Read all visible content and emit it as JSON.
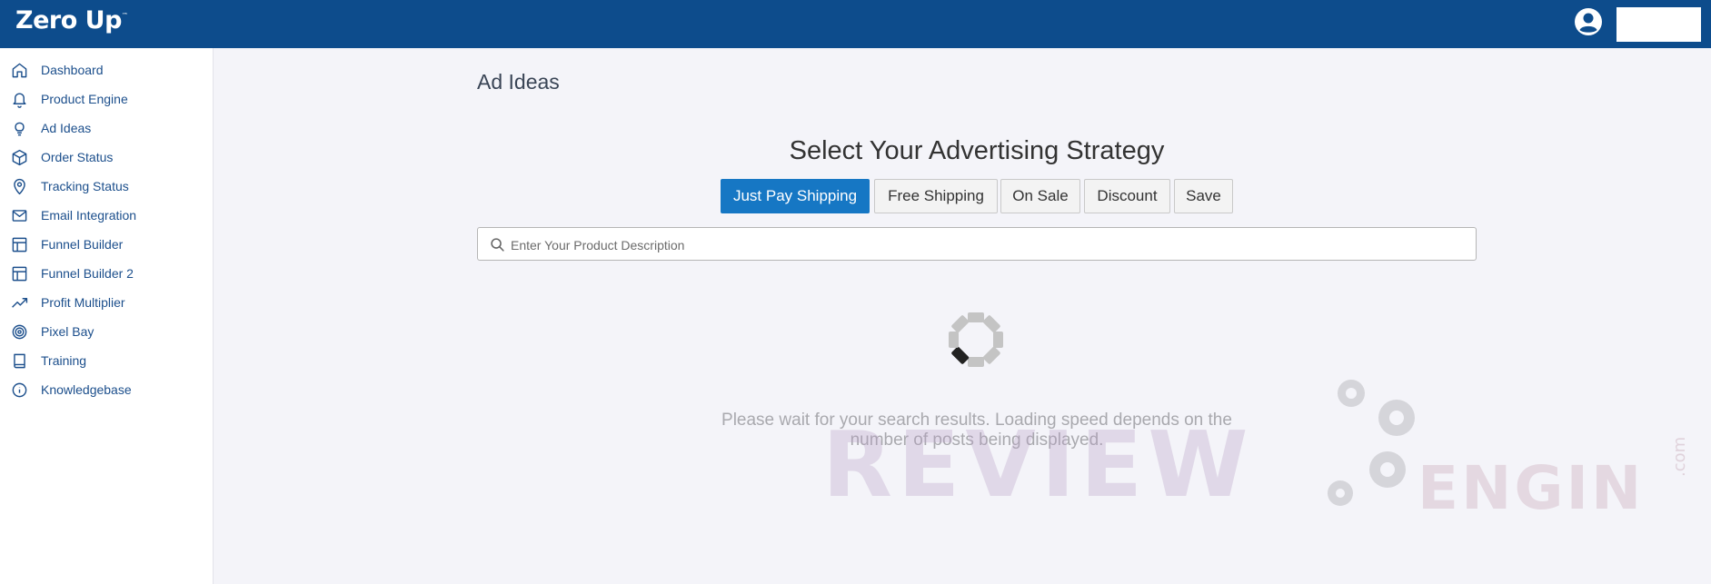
{
  "header": {
    "logo_text": "Zero Up",
    "logo_tm": "™",
    "brand_color": "#0d4c8c"
  },
  "sidebar": {
    "items": [
      {
        "label": "Dashboard",
        "icon": "home-icon"
      },
      {
        "label": "Product Engine",
        "icon": "bell-icon"
      },
      {
        "label": "Ad Ideas",
        "icon": "lightbulb-icon"
      },
      {
        "label": "Order Status",
        "icon": "box-icon"
      },
      {
        "label": "Tracking Status",
        "icon": "map-pin-icon"
      },
      {
        "label": "Email Integration",
        "icon": "mail-icon"
      },
      {
        "label": "Funnel Builder",
        "icon": "layout-icon"
      },
      {
        "label": "Funnel Builder 2",
        "icon": "layout-icon"
      },
      {
        "label": "Profit Multiplier",
        "icon": "trending-up-icon"
      },
      {
        "label": "Pixel Bay",
        "icon": "target-icon"
      },
      {
        "label": "Training",
        "icon": "book-icon"
      },
      {
        "label": "Knowledgebase",
        "icon": "info-icon"
      }
    ]
  },
  "main": {
    "page_title": "Ad Ideas",
    "strategy_title": "Select Your Advertising Strategy",
    "tabs": [
      {
        "label": "Just Pay Shipping",
        "active": true
      },
      {
        "label": "Free Shipping",
        "active": false
      },
      {
        "label": "On Sale",
        "active": false
      },
      {
        "label": "Discount",
        "active": false
      },
      {
        "label": "Save",
        "active": false
      }
    ],
    "search": {
      "placeholder": "Enter Your Product Description",
      "value": ""
    },
    "loading_message": "Please wait for your search results. Loading speed depends on the number of posts being displayed.",
    "accent_color": "#1677c4"
  },
  "watermark": {
    "main": "REVIEW",
    "sub": "ENGIN",
    "suffix": ".com"
  }
}
